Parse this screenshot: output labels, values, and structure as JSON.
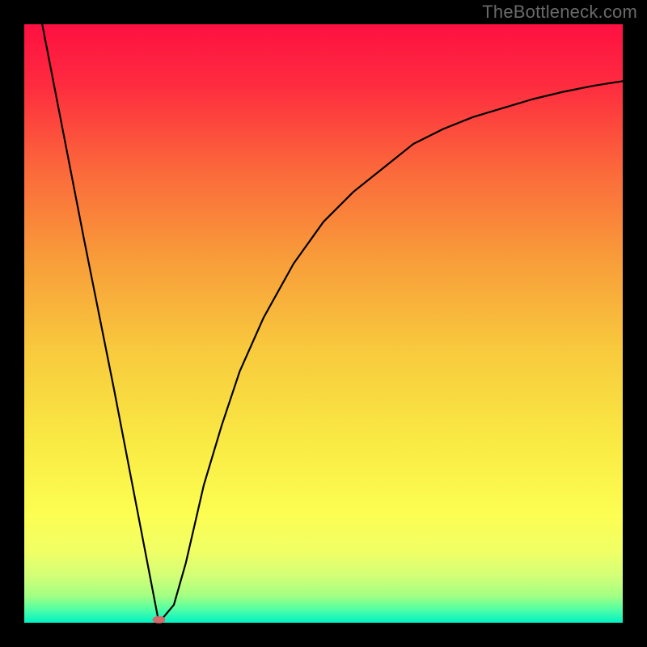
{
  "watermark": "TheBottleneck.com",
  "chart_data": {
    "type": "line",
    "title": "",
    "xlabel": "",
    "ylabel": "",
    "xlim": [
      0,
      100
    ],
    "ylim": [
      0,
      100
    ],
    "grid": false,
    "legend": false,
    "series": [
      {
        "name": "curve",
        "x": [
          3,
          10,
          15,
          20,
          22.5,
          25,
          27,
          30,
          33,
          36,
          40,
          45,
          50,
          55,
          60,
          65,
          70,
          75,
          80,
          85,
          90,
          95,
          100
        ],
        "y": [
          100,
          64,
          39,
          13,
          0,
          3,
          10,
          23,
          33,
          42,
          51,
          60,
          67,
          72,
          76,
          80,
          82.5,
          84.5,
          86,
          87.5,
          88.7,
          89.7,
          90.5
        ]
      }
    ],
    "marker": {
      "x": 22.5,
      "y": 0.5,
      "color": "#d46a6a",
      "rx": 8,
      "ry": 4.5
    },
    "gradient_stops": [
      {
        "offset": 0,
        "color": "#fe1041"
      },
      {
        "offset": 0.1,
        "color": "#fe2b3f"
      },
      {
        "offset": 0.25,
        "color": "#fb6b3b"
      },
      {
        "offset": 0.4,
        "color": "#f89f3a"
      },
      {
        "offset": 0.55,
        "color": "#f8cb3d"
      },
      {
        "offset": 0.7,
        "color": "#f9ea44"
      },
      {
        "offset": 0.82,
        "color": "#fcfe52"
      },
      {
        "offset": 0.88,
        "color": "#f1ff65"
      },
      {
        "offset": 0.92,
        "color": "#d4ff76"
      },
      {
        "offset": 0.955,
        "color": "#a3ff83"
      },
      {
        "offset": 0.975,
        "color": "#5cffa0"
      },
      {
        "offset": 1.0,
        "color": "#00f2c5"
      }
    ],
    "frame_color": "#000000",
    "frame_thickness": 30
  }
}
